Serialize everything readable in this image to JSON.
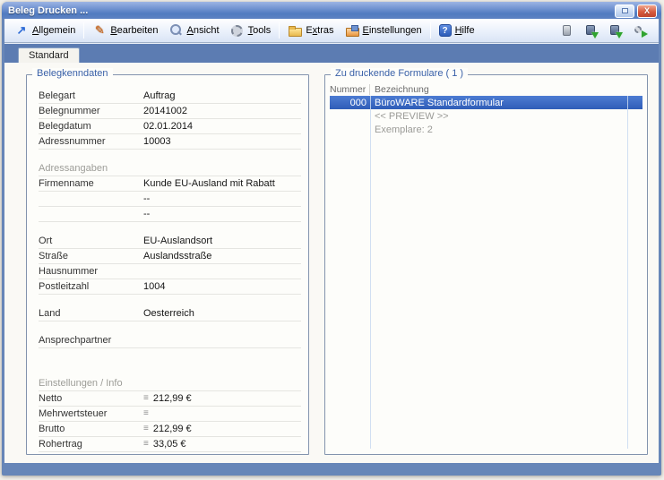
{
  "window": {
    "title": "Beleg Drucken ..."
  },
  "icons": {
    "close": "X",
    "sum": "≡",
    "arrow-up-right": "↗",
    "edit-pencil": "✎",
    "help": "?"
  },
  "colors": {
    "titlebar_blue": "#5b7fc2",
    "tabstrip_blue": "#5c7cb2",
    "selection_blue": "#3567c0",
    "groupbox_title_blue": "#3a61a8",
    "close_button_red": "#c84a32",
    "green_arrow": "#2fa32f"
  },
  "menubar": {
    "items": [
      {
        "label": "Allgemein",
        "mnemonic": 0,
        "icon": "arrow-up-right"
      },
      {
        "label": "Bearbeiten",
        "mnemonic": 0,
        "icon": "edit-pencil"
      },
      {
        "label": "Ansicht",
        "mnemonic": 0,
        "icon": "magnifier"
      },
      {
        "label": "Tools",
        "mnemonic": 0,
        "icon": "gear"
      },
      {
        "label": "Extras",
        "mnemonic": 1,
        "icon": "folder-yellow"
      },
      {
        "label": "Einstellungen",
        "mnemonic": 0,
        "icon": "folder-settings"
      },
      {
        "label": "Hilfe",
        "mnemonic": 0,
        "icon": "help"
      }
    ],
    "separators_after": [
      0,
      3,
      5
    ],
    "right_icons": [
      "delete-icon",
      "export-icon",
      "import-icon",
      "print-settings-icon"
    ]
  },
  "tabs": [
    {
      "label": "Standard",
      "active": true
    }
  ],
  "left_panel": {
    "title": "Belegkenndaten",
    "rows": [
      {
        "type": "field",
        "label": "Belegart",
        "value": "Auftrag"
      },
      {
        "type": "field",
        "label": "Belegnummer",
        "value": "20141002"
      },
      {
        "type": "field",
        "label": "Belegdatum",
        "value": "02.01.2014"
      },
      {
        "type": "field",
        "label": "Adressnummer",
        "value": "10003"
      },
      {
        "type": "spacer"
      },
      {
        "type": "section",
        "label": "Adressangaben"
      },
      {
        "type": "field",
        "label": "Firmenname",
        "value": "Kunde EU-Ausland mit Rabatt"
      },
      {
        "type": "field",
        "label": "",
        "value": "--"
      },
      {
        "type": "field",
        "label": "",
        "value": "--"
      },
      {
        "type": "spacer"
      },
      {
        "type": "field",
        "label": "Ort",
        "value": "EU-Auslandsort"
      },
      {
        "type": "field",
        "label": "Straße",
        "value": "Auslandsstraße"
      },
      {
        "type": "field",
        "label": "Hausnummer",
        "value": ""
      },
      {
        "type": "field",
        "label": "Postleitzahl",
        "value": "1004"
      },
      {
        "type": "spacer"
      },
      {
        "type": "field",
        "label": "Land",
        "value": "Oesterreich"
      },
      {
        "type": "spacer"
      },
      {
        "type": "field",
        "label": "Ansprechpartner",
        "value": ""
      },
      {
        "type": "spacer-large"
      },
      {
        "type": "section",
        "label": "Einstellungen / Info"
      },
      {
        "type": "field",
        "label": "Netto",
        "value": "212,99 €",
        "icon": "sum"
      },
      {
        "type": "field",
        "label": "Mehrwertsteuer",
        "value": "",
        "icon": "sum"
      },
      {
        "type": "field",
        "label": "Brutto",
        "value": "212,99 €",
        "icon": "sum"
      },
      {
        "type": "field",
        "label": "Rohertrag",
        "value": "33,05 €",
        "icon": "sum"
      }
    ]
  },
  "right_panel": {
    "title": "Zu druckende Formulare ( 1 )",
    "columns": [
      "Nummer",
      "Bezeichnung"
    ],
    "rows": [
      {
        "nummer": "000",
        "bezeichnung": "BüroWARE Standardformular",
        "selected": true,
        "muted": false
      },
      {
        "nummer": "",
        "bezeichnung": "<< PREVIEW >>",
        "selected": false,
        "muted": true
      },
      {
        "nummer": "",
        "bezeichnung": "Exemplare: 2",
        "selected": false,
        "muted": true
      }
    ]
  }
}
